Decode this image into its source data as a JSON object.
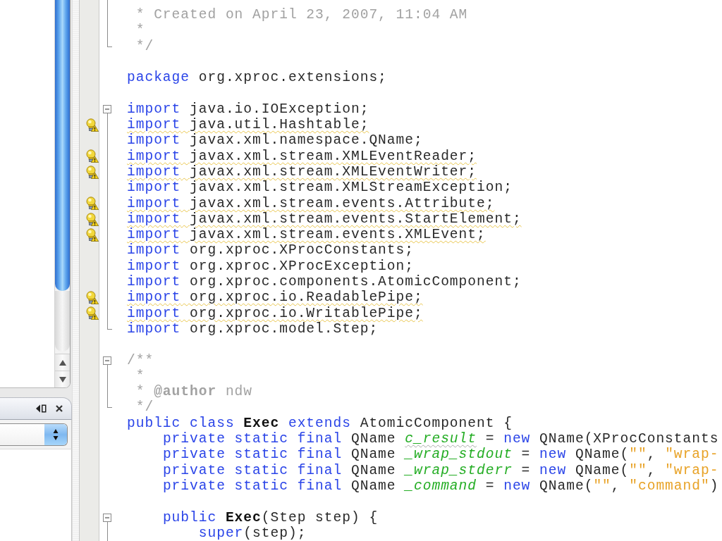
{
  "editor": {
    "lines": [
      {
        "kind": "foldbody",
        "hint": false,
        "tokens": [
          {
            "text": " * Created on April 23, 2007, 11:04 AM",
            "kind": "comment"
          }
        ]
      },
      {
        "kind": "foldbody",
        "hint": false,
        "tokens": [
          {
            "text": " *",
            "kind": "comment"
          }
        ]
      },
      {
        "kind": "foldend",
        "hint": false,
        "tokens": [
          {
            "text": " */",
            "kind": "comment"
          }
        ]
      },
      {
        "kind": "plain"
      },
      {
        "kind": "plain",
        "hint": false,
        "tokens": [
          {
            "text": "package",
            "kind": "keyword"
          },
          {
            "text": " org.xproc.extensions;",
            "kind": "plain"
          }
        ]
      },
      {
        "kind": "plain"
      },
      {
        "kind": "foldstart",
        "hint": false,
        "tokens": [
          {
            "text": "import",
            "kind": "keyword"
          },
          {
            "text": " java.io.IOException;",
            "kind": "plain"
          }
        ]
      },
      {
        "kind": "foldbody",
        "hint": true,
        "tokens": [
          {
            "text": "import",
            "kind": "keyword"
          },
          {
            "text": " java.util.Hashtable;",
            "kind": "plain"
          }
        ]
      },
      {
        "kind": "foldbody",
        "hint": false,
        "tokens": [
          {
            "text": "import",
            "kind": "keyword"
          },
          {
            "text": " javax.xml.namespace.QName;",
            "kind": "plain"
          }
        ]
      },
      {
        "kind": "foldbody",
        "hint": true,
        "tokens": [
          {
            "text": "import",
            "kind": "keyword"
          },
          {
            "text": " javax.xml.stream.XMLEventReader;",
            "kind": "plain"
          }
        ]
      },
      {
        "kind": "foldbody",
        "hint": true,
        "tokens": [
          {
            "text": "import",
            "kind": "keyword"
          },
          {
            "text": " javax.xml.stream.XMLEventWriter;",
            "kind": "plain"
          }
        ]
      },
      {
        "kind": "foldbody",
        "hint": false,
        "tokens": [
          {
            "text": "import",
            "kind": "keyword"
          },
          {
            "text": " javax.xml.stream.XMLStreamException;",
            "kind": "plain"
          }
        ]
      },
      {
        "kind": "foldbody",
        "hint": true,
        "tokens": [
          {
            "text": "import",
            "kind": "keyword"
          },
          {
            "text": " javax.xml.stream.events.Attribute;",
            "kind": "plain"
          }
        ]
      },
      {
        "kind": "foldbody",
        "hint": true,
        "tokens": [
          {
            "text": "import",
            "kind": "keyword"
          },
          {
            "text": " javax.xml.stream.events.StartElement;",
            "kind": "plain"
          }
        ]
      },
      {
        "kind": "foldbody",
        "hint": true,
        "tokens": [
          {
            "text": "import",
            "kind": "keyword"
          },
          {
            "text": " javax.xml.stream.events.XMLEvent;",
            "kind": "plain"
          }
        ]
      },
      {
        "kind": "foldbody",
        "hint": false,
        "tokens": [
          {
            "text": "import",
            "kind": "keyword"
          },
          {
            "text": " org.xproc.XProcConstants;",
            "kind": "plain"
          }
        ]
      },
      {
        "kind": "foldbody",
        "hint": false,
        "tokens": [
          {
            "text": "import",
            "kind": "keyword"
          },
          {
            "text": " org.xproc.XProcException;",
            "kind": "plain"
          }
        ]
      },
      {
        "kind": "foldbody",
        "hint": false,
        "tokens": [
          {
            "text": "import",
            "kind": "keyword"
          },
          {
            "text": " org.xproc.components.AtomicComponent;",
            "kind": "plain"
          }
        ]
      },
      {
        "kind": "foldbody",
        "hint": true,
        "tokens": [
          {
            "text": "import",
            "kind": "keyword"
          },
          {
            "text": " org.xproc.io.ReadablePipe;",
            "kind": "plain"
          }
        ]
      },
      {
        "kind": "foldbody",
        "hint": true,
        "tokens": [
          {
            "text": "import",
            "kind": "keyword"
          },
          {
            "text": " org.xproc.io.WritablePipe;",
            "kind": "plain"
          }
        ]
      },
      {
        "kind": "foldend",
        "hint": false,
        "tokens": [
          {
            "text": "import",
            "kind": "keyword"
          },
          {
            "text": " org.xproc.model.Step;",
            "kind": "plain"
          }
        ]
      },
      {
        "kind": "plain"
      },
      {
        "kind": "foldstart",
        "hint": false,
        "tokens": [
          {
            "text": "/**",
            "kind": "comment"
          }
        ]
      },
      {
        "kind": "foldbody",
        "hint": false,
        "tokens": [
          {
            "text": " *",
            "kind": "comment"
          }
        ]
      },
      {
        "kind": "foldbody",
        "hint": false,
        "tokens": [
          {
            "text": " * ",
            "kind": "comment"
          },
          {
            "text": "@author",
            "kind": "doctag"
          },
          {
            "text": " ndw",
            "kind": "comment"
          }
        ]
      },
      {
        "kind": "foldend",
        "hint": false,
        "tokens": [
          {
            "text": " */",
            "kind": "comment"
          }
        ]
      },
      {
        "kind": "plain",
        "hint": false,
        "tokens": [
          {
            "text": "public class",
            "kind": "keyword"
          },
          {
            "text": " Exec",
            "kind": "declaration"
          },
          {
            "text": " extends",
            "kind": "keyword"
          },
          {
            "text": " AtomicComponent {",
            "kind": "plain"
          }
        ]
      },
      {
        "kind": "plain",
        "hint": false,
        "tokens": [
          {
            "text": "    private static final",
            "kind": "keyword"
          },
          {
            "text": " QName ",
            "kind": "plain"
          },
          {
            "text": "c_result",
            "kind": "unused"
          },
          {
            "text": " = ",
            "kind": "plain"
          },
          {
            "text": "new",
            "kind": "keyword"
          },
          {
            "text": " QName(XProcConstants",
            "kind": "plain"
          }
        ]
      },
      {
        "kind": "plain",
        "hint": false,
        "tokens": [
          {
            "text": "    private static final",
            "kind": "keyword"
          },
          {
            "text": " QName ",
            "kind": "plain"
          },
          {
            "text": "_wrap_stdout",
            "kind": "field"
          },
          {
            "text": " = ",
            "kind": "plain"
          },
          {
            "text": "new",
            "kind": "keyword"
          },
          {
            "text": " QName(",
            "kind": "plain"
          },
          {
            "text": "\"\"",
            "kind": "string"
          },
          {
            "text": ", ",
            "kind": "plain"
          },
          {
            "text": "\"wrap-",
            "kind": "string"
          }
        ]
      },
      {
        "kind": "plain",
        "hint": false,
        "tokens": [
          {
            "text": "    private static final",
            "kind": "keyword"
          },
          {
            "text": " QName ",
            "kind": "plain"
          },
          {
            "text": "_wrap_stderr",
            "kind": "field"
          },
          {
            "text": " = ",
            "kind": "plain"
          },
          {
            "text": "new",
            "kind": "keyword"
          },
          {
            "text": " QName(",
            "kind": "plain"
          },
          {
            "text": "\"\"",
            "kind": "string"
          },
          {
            "text": ", ",
            "kind": "plain"
          },
          {
            "text": "\"wrap-",
            "kind": "string"
          }
        ]
      },
      {
        "kind": "plain",
        "hint": false,
        "tokens": [
          {
            "text": "    private static final",
            "kind": "keyword"
          },
          {
            "text": " QName ",
            "kind": "plain"
          },
          {
            "text": "_command",
            "kind": "field"
          },
          {
            "text": " = ",
            "kind": "plain"
          },
          {
            "text": "new",
            "kind": "keyword"
          },
          {
            "text": " QName(",
            "kind": "plain"
          },
          {
            "text": "\"\"",
            "kind": "string"
          },
          {
            "text": ", ",
            "kind": "plain"
          },
          {
            "text": "\"command\"",
            "kind": "string"
          },
          {
            "text": ")",
            "kind": "plain"
          }
        ]
      },
      {
        "kind": "plain"
      },
      {
        "kind": "foldstart",
        "hint": false,
        "tokens": [
          {
            "text": "    public",
            "kind": "keyword"
          },
          {
            "text": " Exec",
            "kind": "declaration"
          },
          {
            "text": "(Step step) {",
            "kind": "plain"
          }
        ]
      },
      {
        "kind": "foldbody",
        "hint": false,
        "tokens": [
          {
            "text": "        super",
            "kind": "keyword"
          },
          {
            "text": "(step);",
            "kind": "plain"
          }
        ]
      }
    ]
  }
}
